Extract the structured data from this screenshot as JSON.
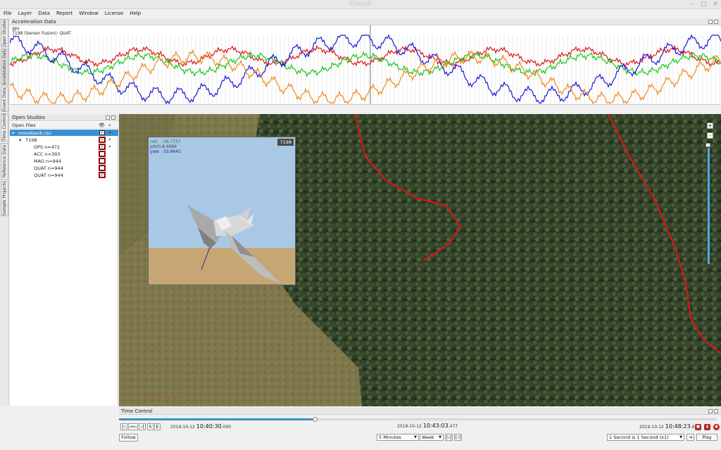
{
  "window": {
    "title": "Firetail"
  },
  "menu": [
    "File",
    "Layer",
    "Data",
    "Report",
    "Window",
    "License",
    "Help"
  ],
  "vtabs": [
    "Open Studies",
    "Acceleration Data",
    "Event Data",
    "Time Control",
    "Reference Data",
    "Sample Projects"
  ],
  "accel": {
    "title": "Acceleration Data",
    "labels": [
      "gps",
      "7198 (Sensor Fusion): QUAT"
    ],
    "colors": {
      "red": "#e01818",
      "green": "#19c81c",
      "blue": "#1a1ad8",
      "orange": "#f08a1c"
    }
  },
  "studies": {
    "title": "Open Studies",
    "files_label": "Open Files",
    "root": "movebank.csv",
    "animal": "7198",
    "items": [
      {
        "label": "GPS n=472",
        "checked": true
      },
      {
        "label": "ACC n=393",
        "checked": false
      },
      {
        "label": "MAG n=944",
        "checked": false
      },
      {
        "label": "QUAT n=944",
        "checked": false
      },
      {
        "label": "QUAT n=944",
        "checked": true
      }
    ]
  },
  "orientation": {
    "id": "7198",
    "roll_label": "roll:",
    "roll": "-36.7757",
    "pitch_label": "pitch:",
    "pitch": "8.4989",
    "yaw_label": "yaw:",
    "yaw": "-33.6641"
  },
  "map": {
    "zoom_in": "+",
    "zoom_out": "-"
  },
  "time_control": {
    "title": "Time Control",
    "progress_fraction": 0.327,
    "btn_start": "[‹",
    "btn_range": "‹↔›",
    "btn_end": "›]",
    "btn_s": "S",
    "btn_e": "E",
    "start_date": "2019-10-12",
    "start_time": "10:40:30",
    "start_ms": ".000",
    "current_date": "2019-10-12",
    "current_time": "10:43:03",
    "current_ms": ".477",
    "end_date": "2019-10-12",
    "end_time": "10:48:23",
    "end_ms": ".693",
    "step": "5 Minutes",
    "window": "Week",
    "btn_win_left": "[‹]",
    "btn_win_right": "[›]",
    "speed": "1 Second is 1 Second (x1)",
    "play": "Play",
    "follow": "Follow"
  }
}
